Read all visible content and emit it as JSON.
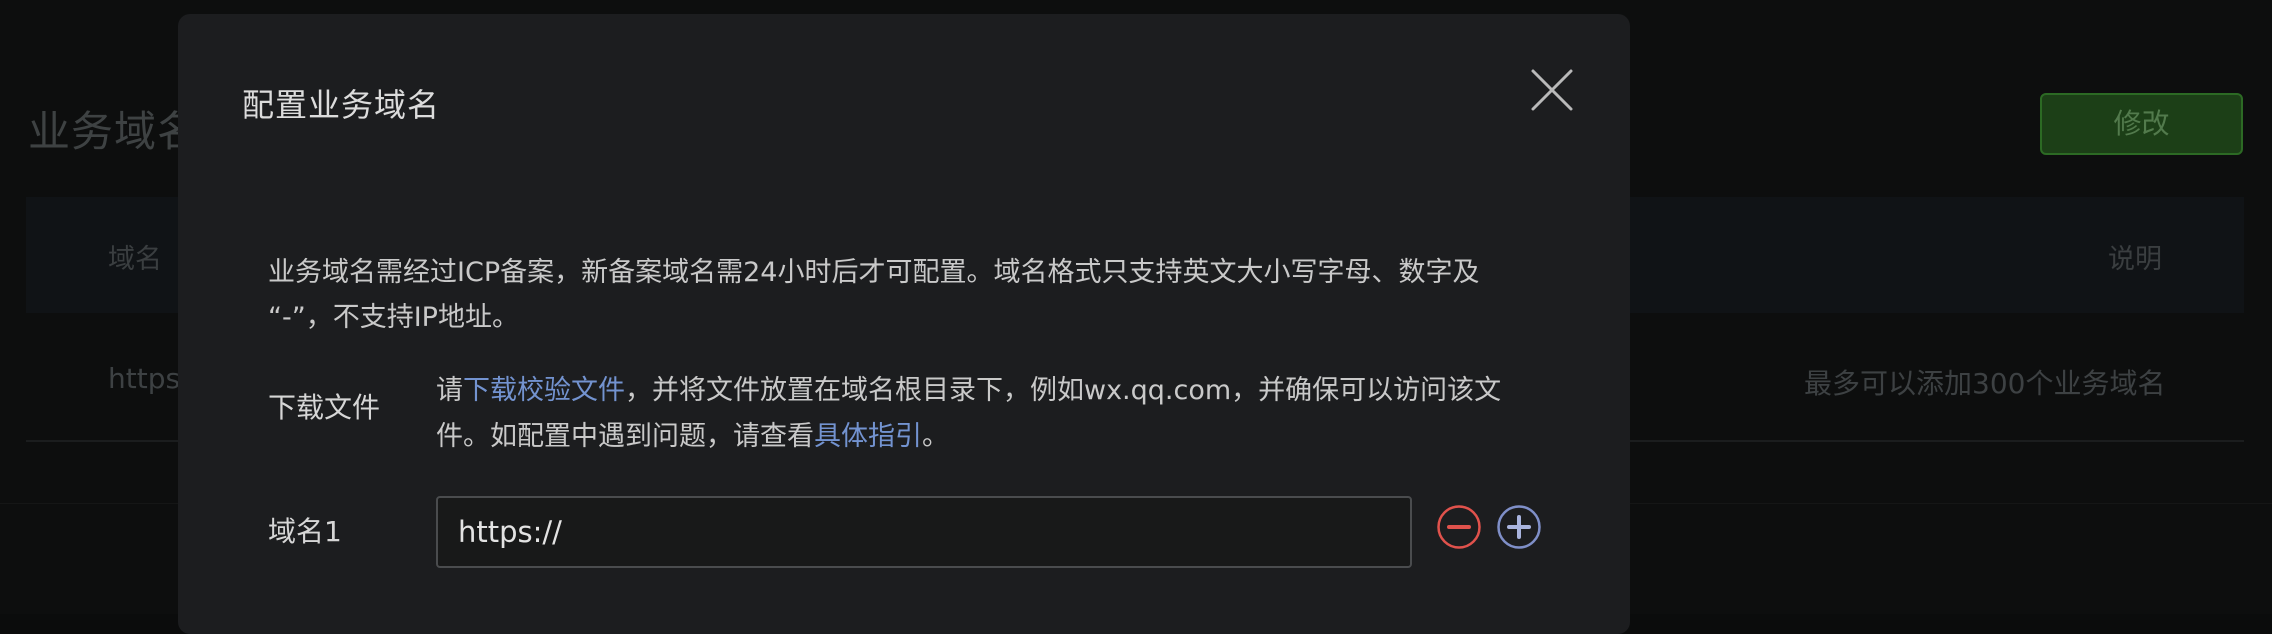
{
  "background": {
    "section_title": "业务域名",
    "edit_button": "修改",
    "table": {
      "headers": {
        "domain": "域名",
        "description": "说明"
      },
      "row": {
        "domain": "https",
        "description": "最多可以添加300个业务域名"
      }
    }
  },
  "modal": {
    "title": "配置业务域名",
    "intro": "业务域名需经过ICP备案，新备案域名需24小时后才可配置。域名格式只支持英文大小写字母、数字及 “-”，不支持IP地址。",
    "download": {
      "label": "下载文件",
      "text_before_link1": "请",
      "link1": "下载校验文件",
      "text_between": "，并将文件放置在域名根目录下，例如wx.qq.com，并确保可以访问该文件。如配置中遇到问题，请查看",
      "link2": "具体指引",
      "text_after": "。"
    },
    "domain_field": {
      "label": "域名1",
      "value": "https://"
    }
  },
  "colors": {
    "accent_link": "#7393d0",
    "remove_red": "#e0524c",
    "add_blue": "#7f8fc8",
    "edit_green": "#2c6a24"
  },
  "icons": {
    "close": "close-icon",
    "remove": "minus-circle-icon",
    "add": "plus-circle-icon"
  }
}
